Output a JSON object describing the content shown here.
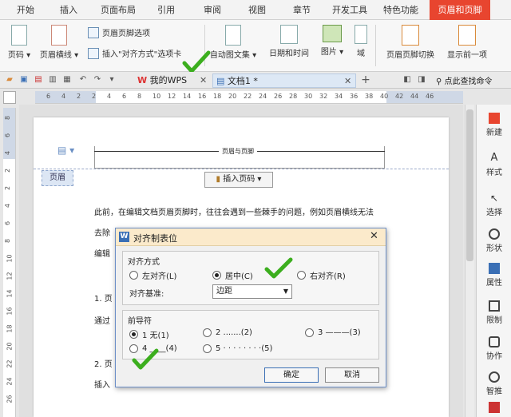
{
  "menu": {
    "tabs": [
      "开始",
      "插入",
      "页面布局",
      "引用",
      "审阅",
      "视图",
      "章节",
      "开发工具",
      "特色功能",
      "页眉和页脚"
    ]
  },
  "ribbon": {
    "page_number": "页码",
    "header_line": "页眉横线",
    "header_footer_options": "页眉页脚选项",
    "insert_align_tab": "插入\"对齐方式\"选项卡",
    "auto_doc_set": "自动图文集",
    "date_time": "日期和时间",
    "picture": "图片",
    "field": "域",
    "header_footer_switch": "页眉页脚切换",
    "show_prev": "显示前一项"
  },
  "quickbar": {
    "tab_wps": "我的WPS",
    "tab_doc": "文档1 *",
    "search": "点此查找命令"
  },
  "ruler": {
    "h_ticks": [
      "6",
      "4",
      "2",
      "2",
      "4",
      "6",
      "8",
      "10",
      "12",
      "14",
      "16",
      "18",
      "20",
      "22",
      "24",
      "26",
      "28",
      "30",
      "32",
      "34",
      "36",
      "38",
      "40",
      "42",
      "44",
      "46"
    ],
    "v_ticks": [
      "8",
      "6",
      "4",
      "2",
      "2",
      "4",
      "6",
      "8",
      "10",
      "12",
      "14",
      "16",
      "18",
      "20",
      "22",
      "24",
      "26"
    ]
  },
  "document": {
    "header_tag": "页眉",
    "header_text": "页眉与页脚",
    "insert_page_number": "插入页码",
    "para1": "此前，在编辑文档页眉页脚时，往往会遇到一些棘手的问题，例如页眉横线无法",
    "line2": "去除",
    "line3": "编辑",
    "line4": "1. 页",
    "line5": "通过",
    "line6": "2. 页",
    "line7": "插入"
  },
  "right_panel": {
    "items": [
      "新建",
      "样式",
      "选择",
      "形状",
      "属性",
      "限制",
      "协作",
      "智推"
    ]
  },
  "dialog": {
    "title": "对齐制表位",
    "group_align": "对齐方式",
    "left": "左对齐(L)",
    "center": "居中(C)",
    "right": "右对齐(R)",
    "base_label": "对齐基准:",
    "base_value": "边距",
    "group_leader": "前导符",
    "leader1": "1 无(1)",
    "leader2": "2 .......(2)",
    "leader3": "3 ———(3)",
    "leader4": "4 ____(4)",
    "leader5": "5 · · · · · · · ·(5)",
    "ok": "确定",
    "cancel": "取消"
  },
  "colors": {
    "accent": "#e8452f",
    "check": "#3cae1e"
  }
}
